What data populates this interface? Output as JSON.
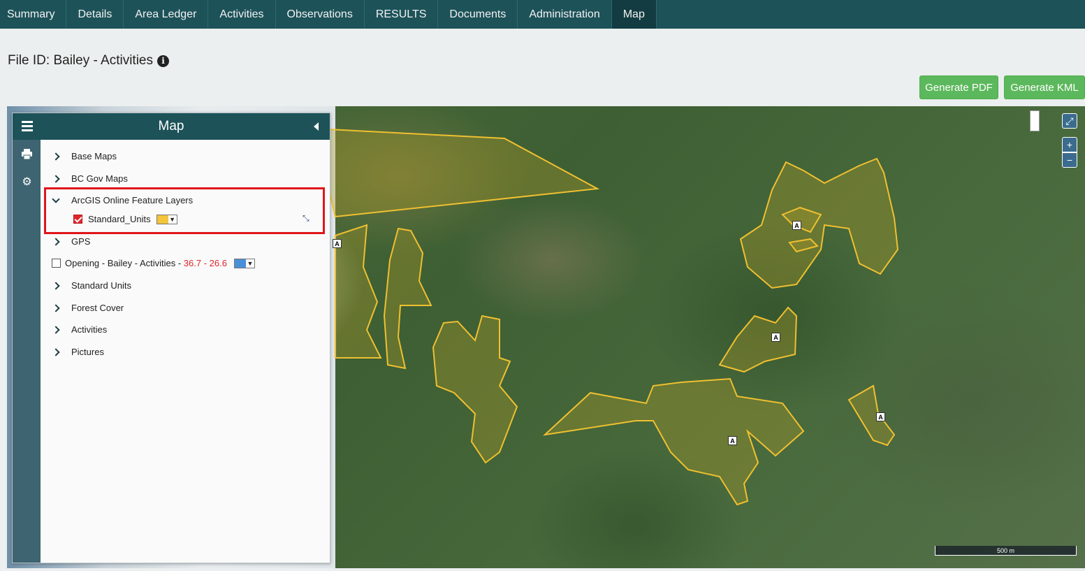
{
  "nav": {
    "tabs": [
      {
        "label": "Summary",
        "active": false
      },
      {
        "label": "Details",
        "active": false
      },
      {
        "label": "Area Ledger",
        "active": false
      },
      {
        "label": "Activities",
        "active": false
      },
      {
        "label": "Observations",
        "active": false
      },
      {
        "label": "RESULTS",
        "active": false
      },
      {
        "label": "Documents",
        "active": false
      },
      {
        "label": "Administration",
        "active": false
      },
      {
        "label": "Map",
        "active": true
      }
    ]
  },
  "header": {
    "title": "File ID: Bailey - Activities",
    "info_icon": "info-circle-icon"
  },
  "actions": {
    "generate_pdf": "Generate PDF",
    "generate_kml": "Generate KML"
  },
  "panel": {
    "title": "Map",
    "side_icons": [
      "print-icon",
      "gear-icon"
    ],
    "layers": {
      "base_maps": "Base Maps",
      "bc_gov_maps": "BC Gov Maps",
      "arcgis": "ArcGIS Online Feature Layers",
      "standard_units_sub": "Standard_Units",
      "gps": "GPS",
      "opening_prefix": "Opening - Bailey - Activities - ",
      "opening_range": "36.7 - 26.6",
      "standard_units": "Standard Units",
      "forest_cover": "Forest Cover",
      "activities": "Activities",
      "pictures": "Pictures"
    },
    "swatch_colors": {
      "standard_units": "#f2c53a",
      "opening": "#4a90d9"
    },
    "highlight_color": "#e0161b"
  },
  "map": {
    "unit_label": "A",
    "scale": "500 m",
    "polygon_color": "#f0c030"
  }
}
